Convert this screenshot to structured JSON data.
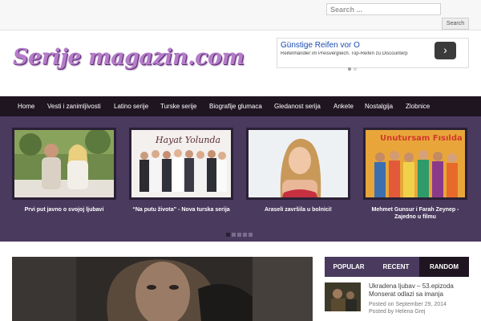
{
  "search": {
    "placeholder": "Search ...",
    "button_label": "Search"
  },
  "site": {
    "logo_text": "Serije magazin.com"
  },
  "ad": {
    "title": "Günstige Reifen vor O",
    "subtitle": "Reifenhändler im Preisvergleich. Top-Reifen zu Discounterp",
    "arrow_icon": "chevron-right-icon"
  },
  "nav": {
    "items": [
      {
        "label": "Home"
      },
      {
        "label": "Vesti i zanimljivosti"
      },
      {
        "label": "Latino serije"
      },
      {
        "label": "Turske serije"
      },
      {
        "label": "Biografije glumaca"
      },
      {
        "label": "Gledanost serija"
      },
      {
        "label": "Ankete"
      },
      {
        "label": "Nostalgija"
      },
      {
        "label": "Zlobnice"
      }
    ]
  },
  "slider": {
    "slides": [
      {
        "caption": "Prvi put javno o svojoj ljubavi"
      },
      {
        "caption": "“Na putu života” - Nova turska serija",
        "image_title": "Hayat Yolunda"
      },
      {
        "caption": "Araseli završila u bolnici!"
      },
      {
        "caption": "Mehmet Gunsur i Farah Zeynep - Zajedno u filmu",
        "image_title": "Unutursam Fısılda"
      }
    ],
    "active_dot": 0,
    "dot_count": 5
  },
  "tabs": {
    "items": [
      {
        "label": "POPULAR"
      },
      {
        "label": "RECENT"
      },
      {
        "label": "RANDOM"
      }
    ],
    "active": "RANDOM"
  },
  "sidebar_post": {
    "title": "Ukradena ljubav – 53.epizoda Monserat odlazi sa imanja",
    "date": "Posted on September 29, 2014",
    "author": "Posted by Helena Grej"
  },
  "colors": {
    "nav_bg": "#1f1521",
    "slider_bg": "#4a3a5e",
    "logo": "#b57dc9",
    "ad_link": "#1a4ab0"
  }
}
